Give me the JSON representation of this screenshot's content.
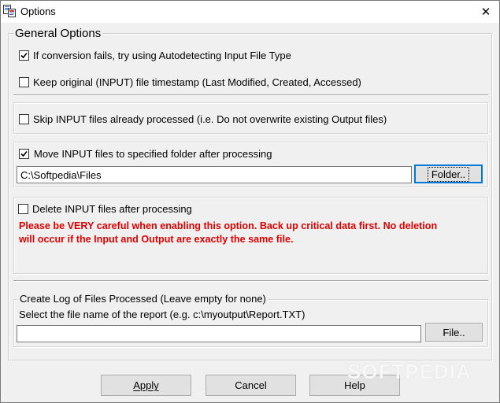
{
  "window": {
    "title": "Options",
    "close_glyph": "✕"
  },
  "general": {
    "legend": "General Options",
    "autodetect": {
      "label": "If conversion fails, try using Autodetecting Input File Type",
      "checked": true
    },
    "timestamp": {
      "label": "Keep original (INPUT) file timestamp (Last Modified, Created, Accessed)",
      "checked": false
    }
  },
  "skip": {
    "label": "Skip INPUT files already processed (i.e. Do not overwrite existing Output files)",
    "checked": false
  },
  "move": {
    "label": "Move INPUT files to specified folder after processing",
    "checked": true,
    "folder_value": "C:\\Softpedia\\Files",
    "folder_button": "Folder.."
  },
  "delete": {
    "label": "Delete INPUT files after processing",
    "checked": false,
    "warning_line1": "Please be VERY careful when enabling this option. Back up critical data first.  No deletion",
    "warning_line2": "will occur if the Input and Output are exactly the same file.",
    "warning_color": "#e00000"
  },
  "log": {
    "legend": "Create Log of Files Processed (Leave empty for none)",
    "prompt": "Select the file name of the report (e.g. c:\\myoutput\\Report.TXT)",
    "file_value": "",
    "file_button": "File.."
  },
  "buttons": {
    "apply": "Apply",
    "cancel": "Cancel",
    "help": "Help"
  },
  "watermark": "SOFTPEDIA"
}
